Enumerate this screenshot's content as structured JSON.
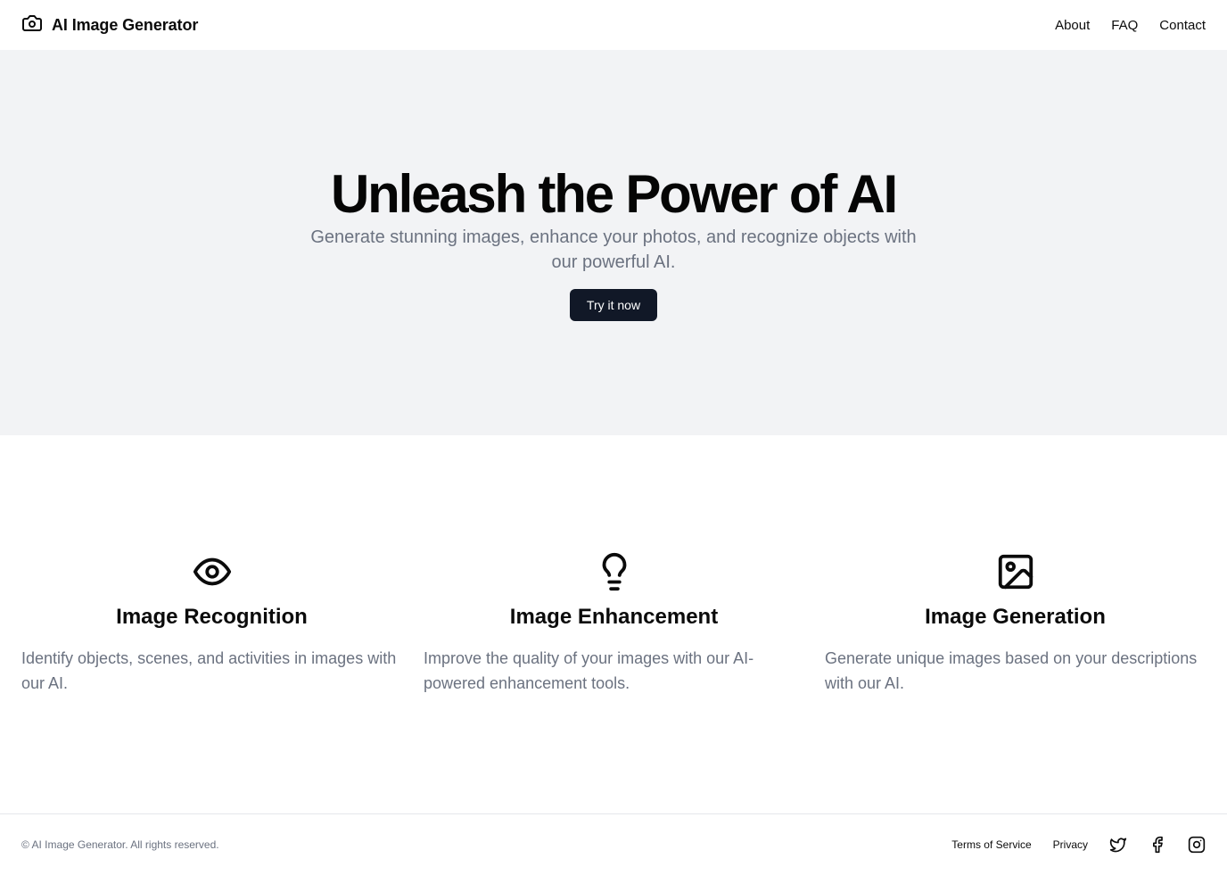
{
  "header": {
    "brand_title": "AI Image Generator",
    "brand_icon": "camera-icon",
    "nav": [
      "About",
      "FAQ",
      "Contact"
    ]
  },
  "hero": {
    "title": "Unleash the Power of AI",
    "subtitle": "Generate stunning images, enhance your photos, and recognize objects with our powerful AI.",
    "cta_label": "Try it now"
  },
  "features": [
    {
      "icon": "eye-icon",
      "title": "Image Recognition",
      "description": "Identify objects, scenes, and activities in images with our AI."
    },
    {
      "icon": "lightbulb-icon",
      "title": "Image Enhancement",
      "description": "Improve the quality of your images with our AI-powered enhancement tools."
    },
    {
      "icon": "image-icon",
      "title": "Image Generation",
      "description": "Generate unique images based on your descriptions with our AI."
    }
  ],
  "footer": {
    "copyright": "© AI Image Generator. All rights reserved.",
    "links": [
      "Terms of Service",
      "Privacy"
    ],
    "social_icons": [
      "twitter-icon",
      "facebook-icon",
      "instagram-icon"
    ]
  },
  "colors": {
    "hero_bg": "#f2f3f5",
    "button_bg": "#111827",
    "muted_text": "#6b7280",
    "border": "#e5e7eb"
  }
}
